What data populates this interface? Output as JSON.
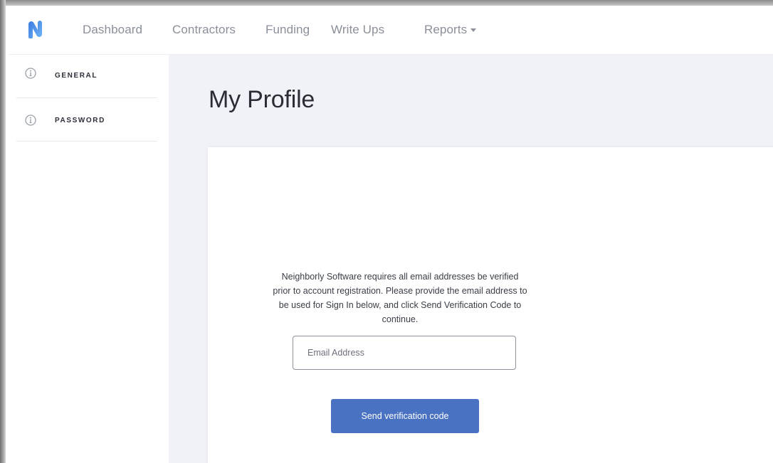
{
  "nav": {
    "logo_icon": "neighborly-logo-icon",
    "items": [
      {
        "label": "Dashboard"
      },
      {
        "label": "Contractors"
      },
      {
        "label": "Funding"
      },
      {
        "label": "Write Ups"
      },
      {
        "label": "Reports"
      }
    ]
  },
  "sidebar": {
    "items": [
      {
        "label": "GENERAL",
        "icon": "info-icon"
      },
      {
        "label": "PASSWORD",
        "icon": "info-icon"
      }
    ]
  },
  "main": {
    "title": "My Profile",
    "card": {
      "instructions": "Neighborly Software requires all email addresses be verified prior to account registration. Please provide the email address to be used for Sign In below, and click Send Verification Code to continue.",
      "email_placeholder": "Email Address",
      "email_value": "",
      "send_button_label": "Send verification code"
    }
  },
  "colors": {
    "accent": "#4a72c2",
    "logo_blue": "#4a8fe7",
    "main_bg": "#f0f2f7",
    "nav_text": "#8a8f99"
  }
}
